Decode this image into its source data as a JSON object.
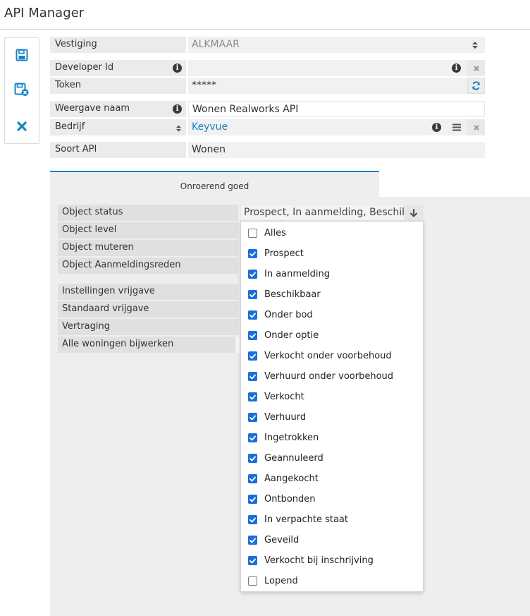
{
  "app": {
    "title": "API Manager"
  },
  "toolbar": {
    "save": "save-icon",
    "save_close": "save-close-icon",
    "cancel": "close-icon"
  },
  "form": {
    "vestiging": {
      "label": "Vestiging",
      "value": "ALKMAAR"
    },
    "developer_id": {
      "label": "Developer Id",
      "value": ""
    },
    "token": {
      "label": "Token",
      "value": "*****"
    },
    "weergave_naam": {
      "label": "Weergave naam",
      "value": "Wonen Realworks API"
    },
    "bedrijf": {
      "label": "Bedrijf",
      "value": "Keyvue"
    },
    "soort_api": {
      "label": "Soort API",
      "value": "Wonen"
    }
  },
  "tabs": [
    {
      "label": "Onroerend goed",
      "active": true
    }
  ],
  "settings": {
    "fields": [
      "Object status",
      "Object level",
      "Object muteren",
      "Object Aanmeldingsreden",
      "Instellingen vrijgave",
      "Standaard vrijgave",
      "Vertraging",
      "Alle woningen bijwerken"
    ],
    "object_status_value": "Prospect, In aanmelding, Beschikbaar"
  },
  "status_options": [
    {
      "label": "Alles",
      "checked": false
    },
    {
      "label": "Prospect",
      "checked": true
    },
    {
      "label": "In aanmelding",
      "checked": true
    },
    {
      "label": "Beschikbaar",
      "checked": true
    },
    {
      "label": "Onder bod",
      "checked": true
    },
    {
      "label": "Onder optie",
      "checked": true
    },
    {
      "label": "Verkocht onder voorbehoud",
      "checked": true
    },
    {
      "label": "Verhuurd onder voorbehoud",
      "checked": true
    },
    {
      "label": "Verkocht",
      "checked": true
    },
    {
      "label": "Verhuurd",
      "checked": true
    },
    {
      "label": "Ingetrokken",
      "checked": true
    },
    {
      "label": "Geannuleerd",
      "checked": true
    },
    {
      "label": "Aangekocht",
      "checked": true
    },
    {
      "label": "Ontbonden",
      "checked": true
    },
    {
      "label": "In verpachte staat",
      "checked": true
    },
    {
      "label": "Geveild",
      "checked": true
    },
    {
      "label": "Verkocht bij inschrijving",
      "checked": true
    },
    {
      "label": "Lopend",
      "checked": false
    }
  ],
  "colors": {
    "accent": "#1a83c4",
    "checkbox": "#1a6fd8"
  }
}
